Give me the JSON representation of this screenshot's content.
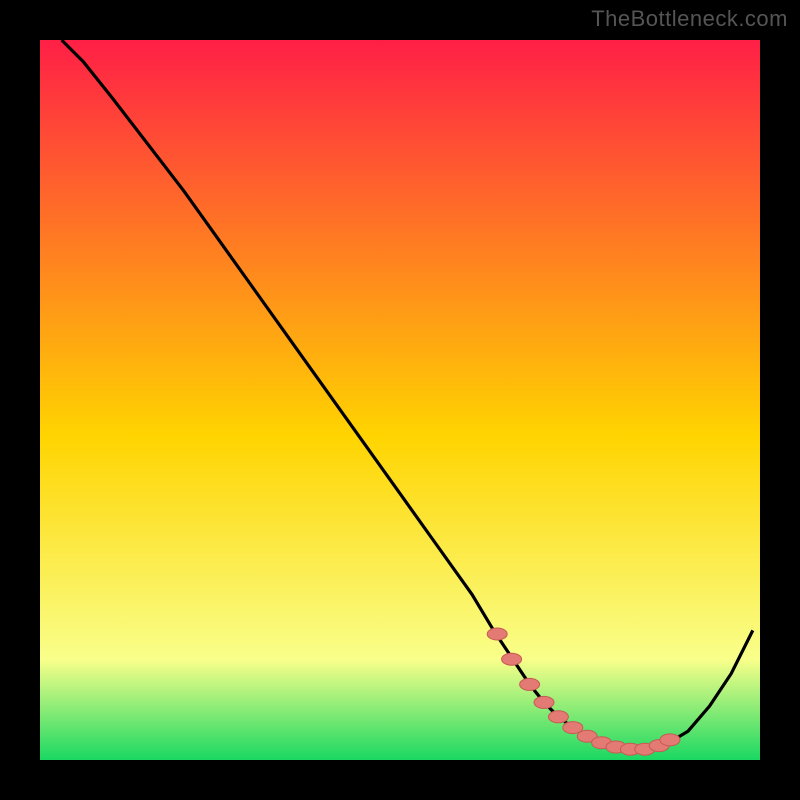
{
  "watermark": "TheBottleneck.com",
  "colors": {
    "background": "#000000",
    "gradient_top": "#ff1f46",
    "gradient_mid": "#ffd400",
    "gradient_low": "#f9ff8a",
    "gradient_bottom": "#19d862",
    "curve": "#000000",
    "marker_fill": "#e47a74",
    "marker_stroke": "#c85a55"
  },
  "chart_data": {
    "type": "line",
    "title": "",
    "xlabel": "",
    "ylabel": "",
    "xlim": [
      0,
      100
    ],
    "ylim": [
      0,
      100
    ],
    "grid": false,
    "series": [
      {
        "name": "bottleneck-curve",
        "x": [
          3,
          6,
          10,
          15,
          20,
          25,
          30,
          35,
          40,
          45,
          50,
          55,
          60,
          63,
          66,
          68,
          70,
          72,
          74,
          76,
          78,
          80,
          82,
          84,
          87,
          90,
          93,
          96,
          99
        ],
        "y": [
          100,
          97,
          92,
          85.5,
          79,
          72,
          65,
          58,
          51,
          44,
          37,
          30,
          23,
          18,
          13.5,
          10.5,
          8,
          6,
          4.5,
          3.3,
          2.4,
          1.8,
          1.5,
          1.5,
          2.2,
          4,
          7.5,
          12,
          18
        ]
      }
    ],
    "markers": {
      "name": "highlighted-points",
      "x": [
        63.5,
        65.5,
        68,
        70,
        72,
        74,
        76,
        78,
        80,
        82,
        84,
        86,
        87.5
      ],
      "y": [
        17.5,
        14,
        10.5,
        8,
        6,
        4.5,
        3.3,
        2.4,
        1.8,
        1.5,
        1.5,
        2.0,
        2.8
      ]
    }
  }
}
